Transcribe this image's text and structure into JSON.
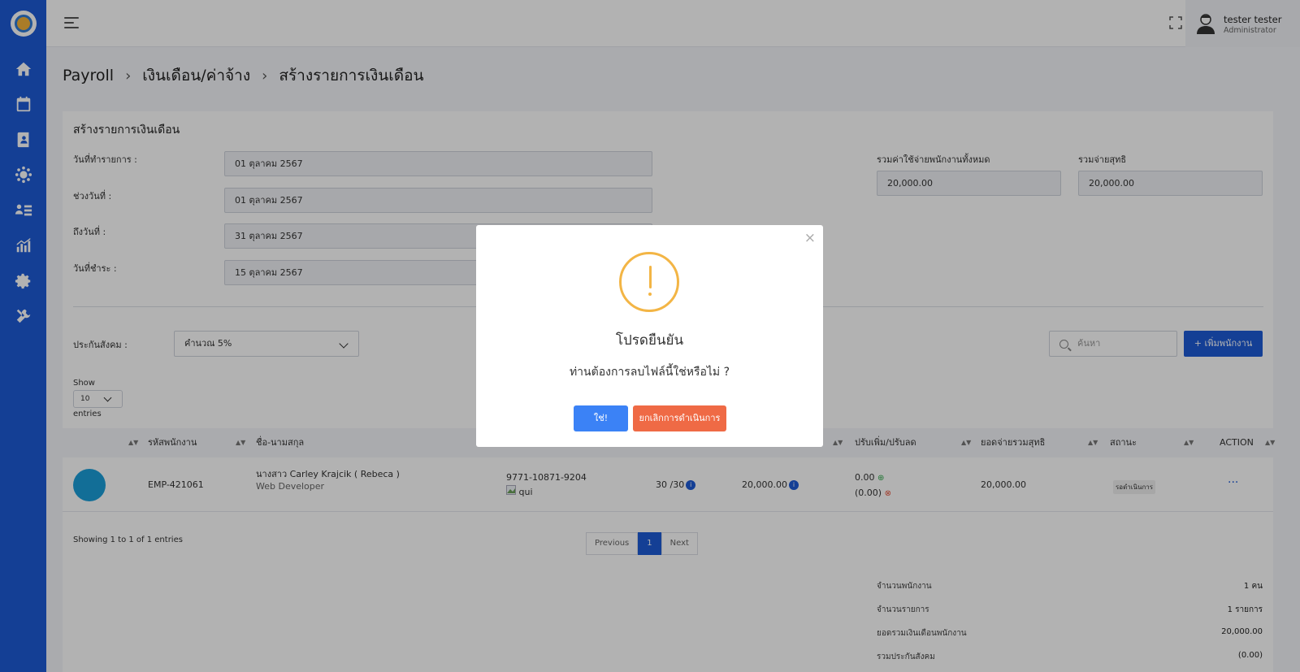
{
  "sidebar": {
    "icons": [
      "home-icon",
      "calendar-dollar-icon",
      "contact-book-icon",
      "users-gear-icon",
      "user-list-icon",
      "chart-icon",
      "settings-icon",
      "tools-icon"
    ]
  },
  "user": {
    "name": "tester tester",
    "role": "Administrator"
  },
  "breadcrumb": {
    "item1": "Payroll",
    "item2": "เงินเดือน/ค่าจ้าง",
    "item3": "สร้างรายการเงินเดือน"
  },
  "form": {
    "title": "สร้างรายการเงินเดือน",
    "doc_date_label": "วันที่ทำรายการ :",
    "doc_date_value": "01 ตุลาคม 2567",
    "period_from_label": "ช่วงวันที่ :",
    "period_from_value": "01 ตุลาคม 2567",
    "period_to_label": "ถึงวันที่ :",
    "period_to_value": "31 ตุลาคม 2567",
    "pay_date_label": "วันที่ชำระ :",
    "pay_date_value": "15 ตุลาคม 2567",
    "total_cost_label": "รวมค่าใช้จ่ายพนักงานทั้งหมด",
    "total_cost_value": "20,000.00",
    "net_total_label": "รวมจ่ายสุทธิ",
    "net_total_value": "20,000.00",
    "social_security_label": "ประกันสังคม :",
    "social_security_value": "คำนวณ 5%",
    "search_placeholder": "ค้นหา",
    "add_button": "+  เพิ่มพนักงาน"
  },
  "table": {
    "show_label": "Show",
    "page_length": "10",
    "entries_label": "entries",
    "headers": {
      "emp_code": "รหัสพนักงาน",
      "name": "ชื่อ-นามสกุล",
      "adjust": "ปรับเพิ่ม/ปรับลด",
      "net": "ยอดจ่ายรวมสุทธิ",
      "status": "สถานะ",
      "action": "ACTION"
    },
    "rows": [
      {
        "emp_code": "EMP-421061",
        "name": "นางสาว Carley Krajcik ( Rebeca )",
        "position": "Web Developer",
        "account": "9771-10871-9204",
        "bank": "qui",
        "days": "30 /30",
        "salary": "20,000.00",
        "add": "0.00",
        "deduct": "(0.00)",
        "net": "20,000.00",
        "status": "รอดำเนินการ",
        "action": "···"
      }
    ],
    "showing": "Showing 1 to 1 of 1 entries",
    "pager": {
      "prev": "Previous",
      "page": "1",
      "next": "Next"
    }
  },
  "summary": [
    {
      "label": "จำนวนพนักงาน",
      "value": "1 คน"
    },
    {
      "label": "จำนวนรายการ",
      "value": "1 รายการ"
    },
    {
      "label": "ยอดรวมเงินเดือนพนักงาน",
      "value": "20,000.00"
    },
    {
      "label": "รวมประกันสังคม",
      "value": "(0.00)"
    }
  ],
  "modal": {
    "close": "×",
    "title": "โปรดยืนยัน",
    "message": "ท่านต้องการลบไฟล์นี้ใช่หรือไม่ ?",
    "confirm": "ใช่!",
    "cancel": "ยกเลิกการดำเนินการ"
  },
  "colors": {
    "primary": "#1d5bd6",
    "warning": "#f3b545",
    "confirm": "#3b82f6",
    "cancel": "#ef6a45"
  }
}
